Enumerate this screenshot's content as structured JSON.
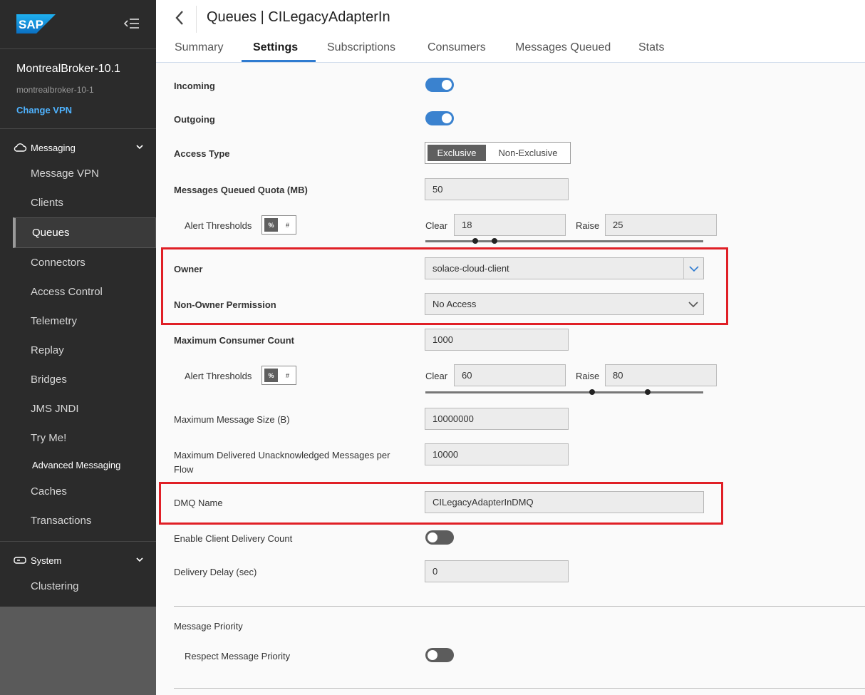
{
  "sidebar": {
    "logo_text": "SAP",
    "broker_name": "MontrealBroker-10.1",
    "broker_id": "montrealbroker-10-1",
    "change_vpn": "Change VPN",
    "messaging_label": "Messaging",
    "system_label": "System",
    "items": {
      "message_vpn": "Message VPN",
      "clients": "Clients",
      "queues": "Queues",
      "connectors": "Connectors",
      "access_control": "Access Control",
      "telemetry": "Telemetry",
      "replay": "Replay",
      "bridges": "Bridges",
      "jms_jndi": "JMS JNDI",
      "try_me": "Try Me!",
      "advanced_messaging": "Advanced Messaging",
      "caches": "Caches",
      "transactions": "Transactions",
      "clustering": "Clustering"
    }
  },
  "header": {
    "title": "Queues | CILegacyAdapterIn",
    "tabs": {
      "summary": "Summary",
      "settings": "Settings",
      "subscriptions": "Subscriptions",
      "consumers": "Consumers",
      "messages_queued": "Messages Queued",
      "stats": "Stats"
    }
  },
  "form": {
    "incoming": {
      "label": "Incoming",
      "on": true
    },
    "outgoing": {
      "label": "Outgoing",
      "on": true
    },
    "access_type": {
      "label": "Access Type",
      "exclusive": "Exclusive",
      "non_exclusive": "Non-Exclusive",
      "selected": "Exclusive"
    },
    "quota": {
      "label": "Messages Queued Quota (MB)",
      "value": "50"
    },
    "quota_alert": {
      "label": "Alert Thresholds",
      "pct": "%",
      "abs": "#",
      "clear_label": "Clear",
      "clear": "18",
      "raise_label": "Raise",
      "raise": "25"
    },
    "owner": {
      "label": "Owner",
      "value": "solace-cloud-client"
    },
    "permission": {
      "label": "Non-Owner Permission",
      "value": "No Access"
    },
    "max_consumers": {
      "label": "Maximum Consumer Count",
      "value": "1000"
    },
    "consumer_alert": {
      "label": "Alert Thresholds",
      "pct": "%",
      "abs": "#",
      "clear_label": "Clear",
      "clear": "60",
      "raise_label": "Raise",
      "raise": "80"
    },
    "max_msg_size": {
      "label": "Maximum Message Size (B)",
      "value": "10000000"
    },
    "max_unacked": {
      "label_line1": "Maximum Delivered Unacknowledged Messages per",
      "label_line2": "Flow",
      "value": "10000"
    },
    "dmq": {
      "label": "DMQ Name",
      "value": "CILegacyAdapterInDMQ"
    },
    "client_delivery_count": {
      "label": "Enable Client Delivery Count",
      "on": false
    },
    "delivery_delay": {
      "label": "Delivery Delay (sec)",
      "value": "0"
    },
    "priority_section": "Message Priority",
    "respect_priority": {
      "label": "Respect Message Priority",
      "on": false
    }
  },
  "colors": {
    "accent": "#2f7bd0",
    "highlight_box": "#e01f26",
    "sidebar_bg": "#2b2b2b",
    "link": "#4fb3ff"
  }
}
